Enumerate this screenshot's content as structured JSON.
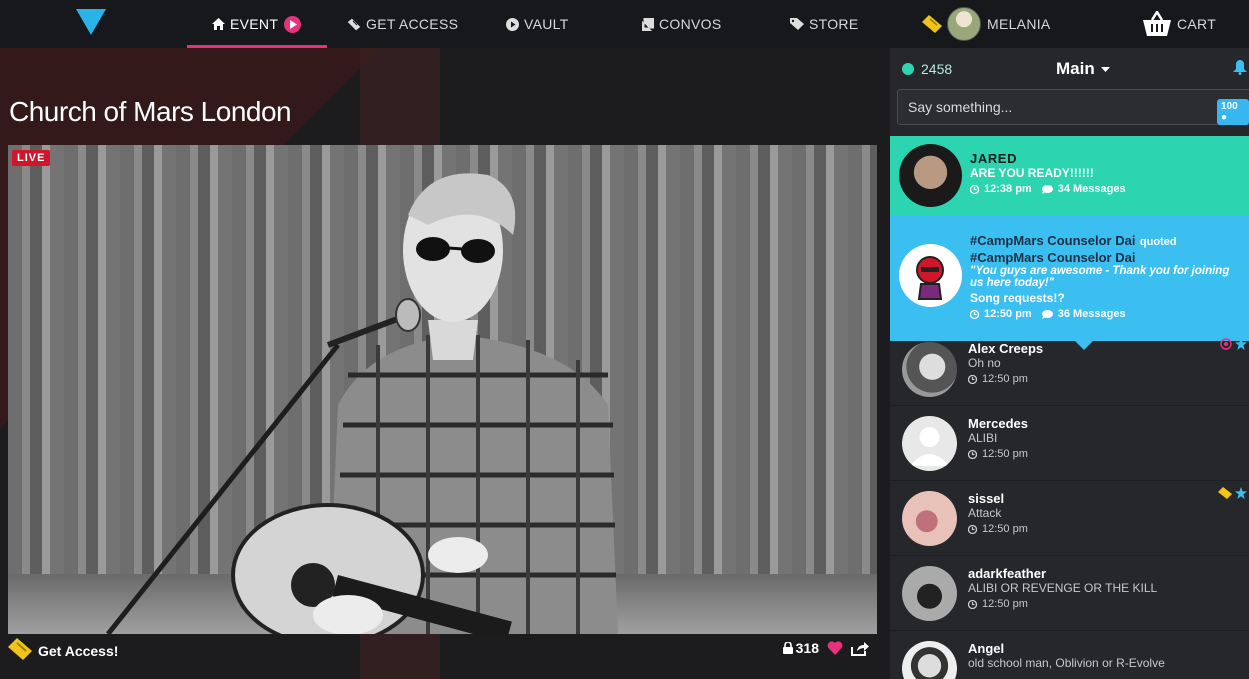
{
  "nav": {
    "items": [
      {
        "label": "EVENT",
        "icon": "home-icon"
      },
      {
        "label": "GET ACCESS",
        "icon": "ticket-icon"
      },
      {
        "label": "VAULT",
        "icon": "play-circle-icon"
      },
      {
        "label": "CONVOS",
        "icon": "book-icon"
      },
      {
        "label": "STORE",
        "icon": "tag-icon"
      }
    ],
    "user_name": "MELANIA",
    "cart_label": "CART"
  },
  "event": {
    "title": "Church of Mars London",
    "live_label": "LIVE",
    "get_access_label": "Get Access!",
    "viewer_count": "318"
  },
  "chat": {
    "online_count": "2458",
    "room": "Main",
    "input_placeholder": "Say something...",
    "char_count": "100",
    "messages": [
      {
        "name": "JARED",
        "text": "ARE YOU READY!!!!!!",
        "time": "12:38 pm",
        "count": "34 Messages"
      },
      {
        "name": "#CampMars Counselor Dai",
        "quoted_label": "quoted",
        "quoted_name": "#CampMars Counselor Dai",
        "quote": "\"You guys are awesome - Thank you for joining us here today!\"",
        "text": "Song requests!?",
        "time": "12:50 pm",
        "count": "36 Messages"
      },
      {
        "name": "Alex Creeps",
        "text": "Oh no",
        "time": "12:50 pm"
      },
      {
        "name": "Mercedes",
        "text": "ALIBI",
        "time": "12:50 pm"
      },
      {
        "name": "sissel",
        "text": "Attack",
        "time": "12:50 pm"
      },
      {
        "name": "adarkfeather",
        "text": "ALIBI OR REVENGE OR THE KILL",
        "time": "12:50 pm"
      },
      {
        "name": "Angel",
        "text": "old school man, Oblivion or R-Evolve",
        "time": ""
      }
    ]
  },
  "colors": {
    "accent_pink": "#e8317c",
    "teal": "#2dd4b0",
    "blue": "#3bbff0",
    "live_red": "#d0162b",
    "logo_blue": "#2ab3e8"
  }
}
